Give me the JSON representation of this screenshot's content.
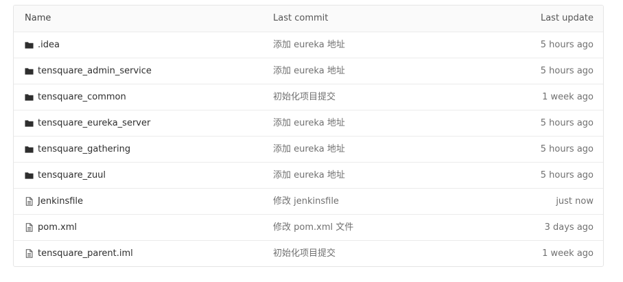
{
  "table": {
    "headers": {
      "name": "Name",
      "last_commit": "Last commit",
      "last_update": "Last update"
    },
    "rows": [
      {
        "type": "folder",
        "icon": "folder-icon",
        "name": ".idea",
        "commit": "添加 eureka 地址",
        "updated": "5 hours ago"
      },
      {
        "type": "folder",
        "icon": "folder-icon",
        "name": "tensquare_admin_service",
        "commit": "添加 eureka 地址",
        "updated": "5 hours ago"
      },
      {
        "type": "folder",
        "icon": "folder-icon",
        "name": "tensquare_common",
        "commit": "初始化项目提交",
        "updated": "1 week ago"
      },
      {
        "type": "folder",
        "icon": "folder-icon",
        "name": "tensquare_eureka_server",
        "commit": "添加 eureka 地址",
        "updated": "5 hours ago"
      },
      {
        "type": "folder",
        "icon": "folder-icon",
        "name": "tensquare_gathering",
        "commit": "添加 eureka 地址",
        "updated": "5 hours ago"
      },
      {
        "type": "folder",
        "icon": "folder-icon",
        "name": "tensquare_zuul",
        "commit": "添加 eureka 地址",
        "updated": "5 hours ago"
      },
      {
        "type": "file",
        "icon": "file-icon",
        "name": "Jenkinsfile",
        "commit": "修改 jenkinsfile",
        "updated": "just now"
      },
      {
        "type": "file",
        "icon": "file-icon",
        "name": "pom.xml",
        "commit": "修改 pom.xml 文件",
        "updated": "3 days ago"
      },
      {
        "type": "file",
        "icon": "file-icon",
        "name": "tensquare_parent.iml",
        "commit": "初始化项目提交",
        "updated": "1 week ago"
      }
    ]
  },
  "colors": {
    "folder_icon": "#2e2e2e",
    "file_icon": "#555555",
    "muted_text": "#707070",
    "border": "#e5e5e5",
    "header_bg": "#fafafa"
  }
}
